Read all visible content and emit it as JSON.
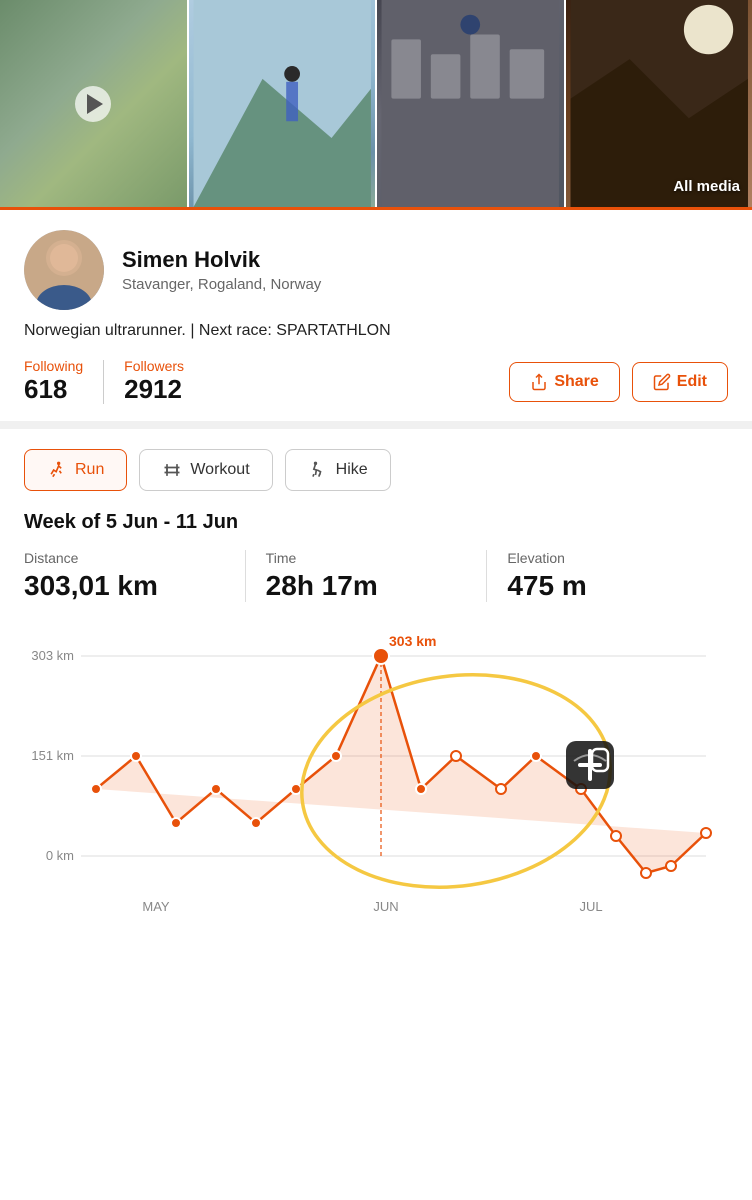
{
  "media": {
    "items": [
      {
        "id": "media-1",
        "type": "video",
        "has_play": true
      },
      {
        "id": "media-2",
        "type": "image"
      },
      {
        "id": "media-3",
        "type": "image"
      },
      {
        "id": "media-4",
        "type": "image"
      }
    ],
    "all_media_label": "All media"
  },
  "profile": {
    "name": "Simen Holvik",
    "location": "Stavanger, Rogaland, Norway",
    "bio": "Norwegian ultrarunner. | Next race: SPARTATHLON",
    "following_label": "Following",
    "following_count": "618",
    "followers_label": "Followers",
    "followers_count": "2912",
    "share_label": "Share",
    "edit_label": "Edit"
  },
  "tabs": [
    {
      "id": "run",
      "label": "Run",
      "active": true,
      "icon": "🥾"
    },
    {
      "id": "workout",
      "label": "Workout",
      "active": false,
      "icon": "⚡"
    },
    {
      "id": "hike",
      "label": "Hike",
      "active": false,
      "icon": "🥾"
    }
  ],
  "week": {
    "label": "Week of 5 Jun - 11 Jun",
    "stats": [
      {
        "label": "Distance",
        "value": "303,01 km"
      },
      {
        "label": "Time",
        "value": "28h 17m"
      },
      {
        "label": "Elevation",
        "value": "475 m"
      }
    ]
  },
  "chart": {
    "annotation": "303 km",
    "y_labels": [
      "303 km",
      "151 km",
      "0 km"
    ],
    "x_labels": [
      "MAY",
      "JUN",
      "JUL"
    ]
  }
}
